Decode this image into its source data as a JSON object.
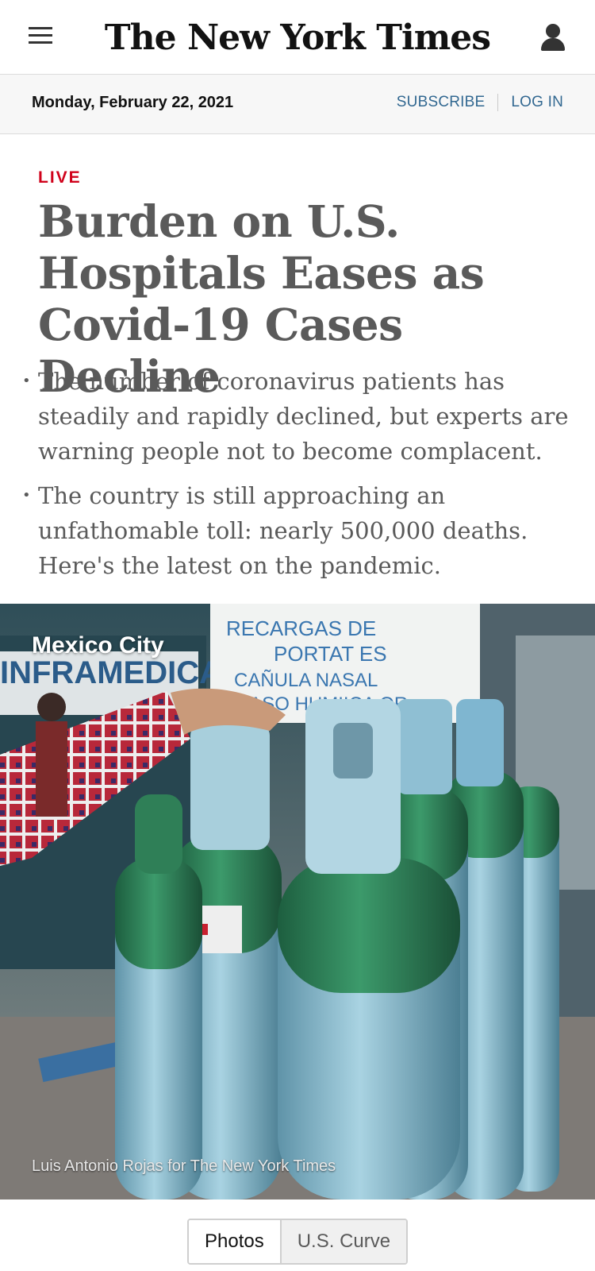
{
  "masthead": {
    "logo": "The New York Times"
  },
  "datebar": {
    "date": "Monday, February 22, 2021",
    "subscribe": "SUBSCRIBE",
    "login": "LOG IN"
  },
  "article": {
    "label": "LIVE",
    "headline": "Burden on U.S. Hospitals Eases as Covid-19 Cases Decline",
    "bullets": [
      "The number of coronavirus patients has steadily and rapidly declined, but experts are warning people not to become complacent.",
      "The country is still approaching an unfathomable toll: nearly 500,000 deaths. Here's the latest on the pandemic."
    ]
  },
  "photo": {
    "location": "Mexico City",
    "credit": "Luis Antonio Rojas for The New York Times",
    "sign_text": "RECARGAS DE PORTAT ES CAÑULA NASAL VASO HUMIICA OR",
    "store_text": "INFRAMEDICA"
  },
  "tabs": {
    "photos": "Photos",
    "us_curve": "U.S. Curve"
  },
  "colors": {
    "live_red": "#d0021b",
    "link_blue": "#326891",
    "headline_gray": "#5a5a5a"
  }
}
